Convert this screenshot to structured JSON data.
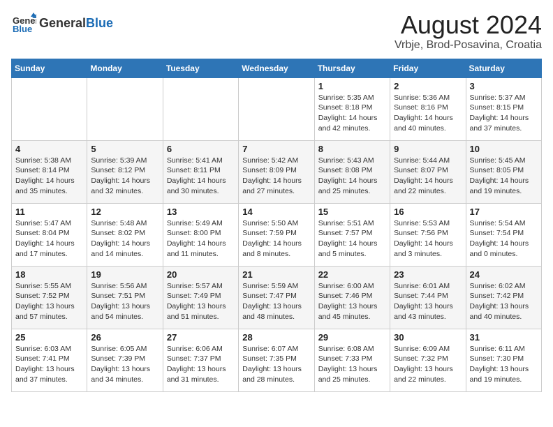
{
  "logo": {
    "general": "General",
    "blue": "Blue"
  },
  "title": "August 2024",
  "subtitle": "Vrbje, Brod-Posavina, Croatia",
  "weekdays": [
    "Sunday",
    "Monday",
    "Tuesday",
    "Wednesday",
    "Thursday",
    "Friday",
    "Saturday"
  ],
  "weeks": [
    [
      {
        "day": "",
        "detail": ""
      },
      {
        "day": "",
        "detail": ""
      },
      {
        "day": "",
        "detail": ""
      },
      {
        "day": "",
        "detail": ""
      },
      {
        "day": "1",
        "detail": "Sunrise: 5:35 AM\nSunset: 8:18 PM\nDaylight: 14 hours\nand 42 minutes."
      },
      {
        "day": "2",
        "detail": "Sunrise: 5:36 AM\nSunset: 8:16 PM\nDaylight: 14 hours\nand 40 minutes."
      },
      {
        "day": "3",
        "detail": "Sunrise: 5:37 AM\nSunset: 8:15 PM\nDaylight: 14 hours\nand 37 minutes."
      }
    ],
    [
      {
        "day": "4",
        "detail": "Sunrise: 5:38 AM\nSunset: 8:14 PM\nDaylight: 14 hours\nand 35 minutes."
      },
      {
        "day": "5",
        "detail": "Sunrise: 5:39 AM\nSunset: 8:12 PM\nDaylight: 14 hours\nand 32 minutes."
      },
      {
        "day": "6",
        "detail": "Sunrise: 5:41 AM\nSunset: 8:11 PM\nDaylight: 14 hours\nand 30 minutes."
      },
      {
        "day": "7",
        "detail": "Sunrise: 5:42 AM\nSunset: 8:09 PM\nDaylight: 14 hours\nand 27 minutes."
      },
      {
        "day": "8",
        "detail": "Sunrise: 5:43 AM\nSunset: 8:08 PM\nDaylight: 14 hours\nand 25 minutes."
      },
      {
        "day": "9",
        "detail": "Sunrise: 5:44 AM\nSunset: 8:07 PM\nDaylight: 14 hours\nand 22 minutes."
      },
      {
        "day": "10",
        "detail": "Sunrise: 5:45 AM\nSunset: 8:05 PM\nDaylight: 14 hours\nand 19 minutes."
      }
    ],
    [
      {
        "day": "11",
        "detail": "Sunrise: 5:47 AM\nSunset: 8:04 PM\nDaylight: 14 hours\nand 17 minutes."
      },
      {
        "day": "12",
        "detail": "Sunrise: 5:48 AM\nSunset: 8:02 PM\nDaylight: 14 hours\nand 14 minutes."
      },
      {
        "day": "13",
        "detail": "Sunrise: 5:49 AM\nSunset: 8:00 PM\nDaylight: 14 hours\nand 11 minutes."
      },
      {
        "day": "14",
        "detail": "Sunrise: 5:50 AM\nSunset: 7:59 PM\nDaylight: 14 hours\nand 8 minutes."
      },
      {
        "day": "15",
        "detail": "Sunrise: 5:51 AM\nSunset: 7:57 PM\nDaylight: 14 hours\nand 5 minutes."
      },
      {
        "day": "16",
        "detail": "Sunrise: 5:53 AM\nSunset: 7:56 PM\nDaylight: 14 hours\nand 3 minutes."
      },
      {
        "day": "17",
        "detail": "Sunrise: 5:54 AM\nSunset: 7:54 PM\nDaylight: 14 hours\nand 0 minutes."
      }
    ],
    [
      {
        "day": "18",
        "detail": "Sunrise: 5:55 AM\nSunset: 7:52 PM\nDaylight: 13 hours\nand 57 minutes."
      },
      {
        "day": "19",
        "detail": "Sunrise: 5:56 AM\nSunset: 7:51 PM\nDaylight: 13 hours\nand 54 minutes."
      },
      {
        "day": "20",
        "detail": "Sunrise: 5:57 AM\nSunset: 7:49 PM\nDaylight: 13 hours\nand 51 minutes."
      },
      {
        "day": "21",
        "detail": "Sunrise: 5:59 AM\nSunset: 7:47 PM\nDaylight: 13 hours\nand 48 minutes."
      },
      {
        "day": "22",
        "detail": "Sunrise: 6:00 AM\nSunset: 7:46 PM\nDaylight: 13 hours\nand 45 minutes."
      },
      {
        "day": "23",
        "detail": "Sunrise: 6:01 AM\nSunset: 7:44 PM\nDaylight: 13 hours\nand 43 minutes."
      },
      {
        "day": "24",
        "detail": "Sunrise: 6:02 AM\nSunset: 7:42 PM\nDaylight: 13 hours\nand 40 minutes."
      }
    ],
    [
      {
        "day": "25",
        "detail": "Sunrise: 6:03 AM\nSunset: 7:41 PM\nDaylight: 13 hours\nand 37 minutes."
      },
      {
        "day": "26",
        "detail": "Sunrise: 6:05 AM\nSunset: 7:39 PM\nDaylight: 13 hours\nand 34 minutes."
      },
      {
        "day": "27",
        "detail": "Sunrise: 6:06 AM\nSunset: 7:37 PM\nDaylight: 13 hours\nand 31 minutes."
      },
      {
        "day": "28",
        "detail": "Sunrise: 6:07 AM\nSunset: 7:35 PM\nDaylight: 13 hours\nand 28 minutes."
      },
      {
        "day": "29",
        "detail": "Sunrise: 6:08 AM\nSunset: 7:33 PM\nDaylight: 13 hours\nand 25 minutes."
      },
      {
        "day": "30",
        "detail": "Sunrise: 6:09 AM\nSunset: 7:32 PM\nDaylight: 13 hours\nand 22 minutes."
      },
      {
        "day": "31",
        "detail": "Sunrise: 6:11 AM\nSunset: 7:30 PM\nDaylight: 13 hours\nand 19 minutes."
      }
    ]
  ]
}
